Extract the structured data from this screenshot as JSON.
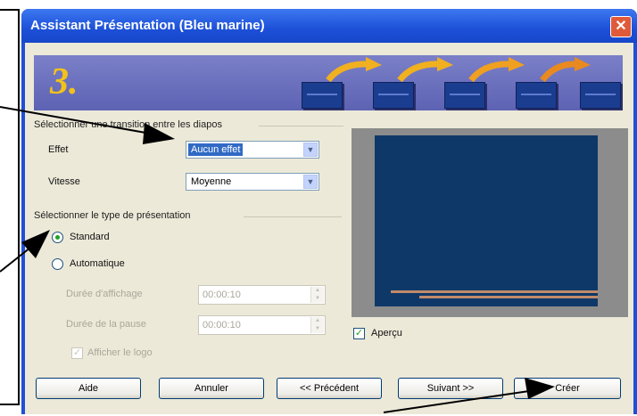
{
  "window": {
    "title": "Assistant Présentation (Bleu marine)",
    "close": "✕"
  },
  "banner": {
    "step": "3."
  },
  "transition_group": {
    "label": "Sélectionner une transition entre les diapos",
    "effect_label": "Effet",
    "effect_value": "Aucun effet",
    "speed_label": "Vitesse",
    "speed_value": "Moyenne"
  },
  "presentation_group": {
    "label": "Sélectionner le type de présentation",
    "standard_label": "Standard",
    "automatic_label": "Automatique",
    "selected": "Standard",
    "display_duration_label": "Durée d'affichage",
    "display_duration_value": "00:00:10",
    "pause_duration_label": "Durée de la pause",
    "pause_duration_value": "00:00:10",
    "show_logo_label": "Afficher le logo"
  },
  "preview": {
    "checkbox_label": "Aperçu",
    "checked": true
  },
  "buttons": {
    "help": "Aide",
    "cancel": "Annuler",
    "previous": "<< Précédent",
    "next": "Suivant >>",
    "create": "Créer"
  },
  "colors": {
    "titlebar": "#1f4fd6",
    "client": "#ece9d8",
    "preview_slide": "#0e3868",
    "banner": "#6a6fbd"
  }
}
